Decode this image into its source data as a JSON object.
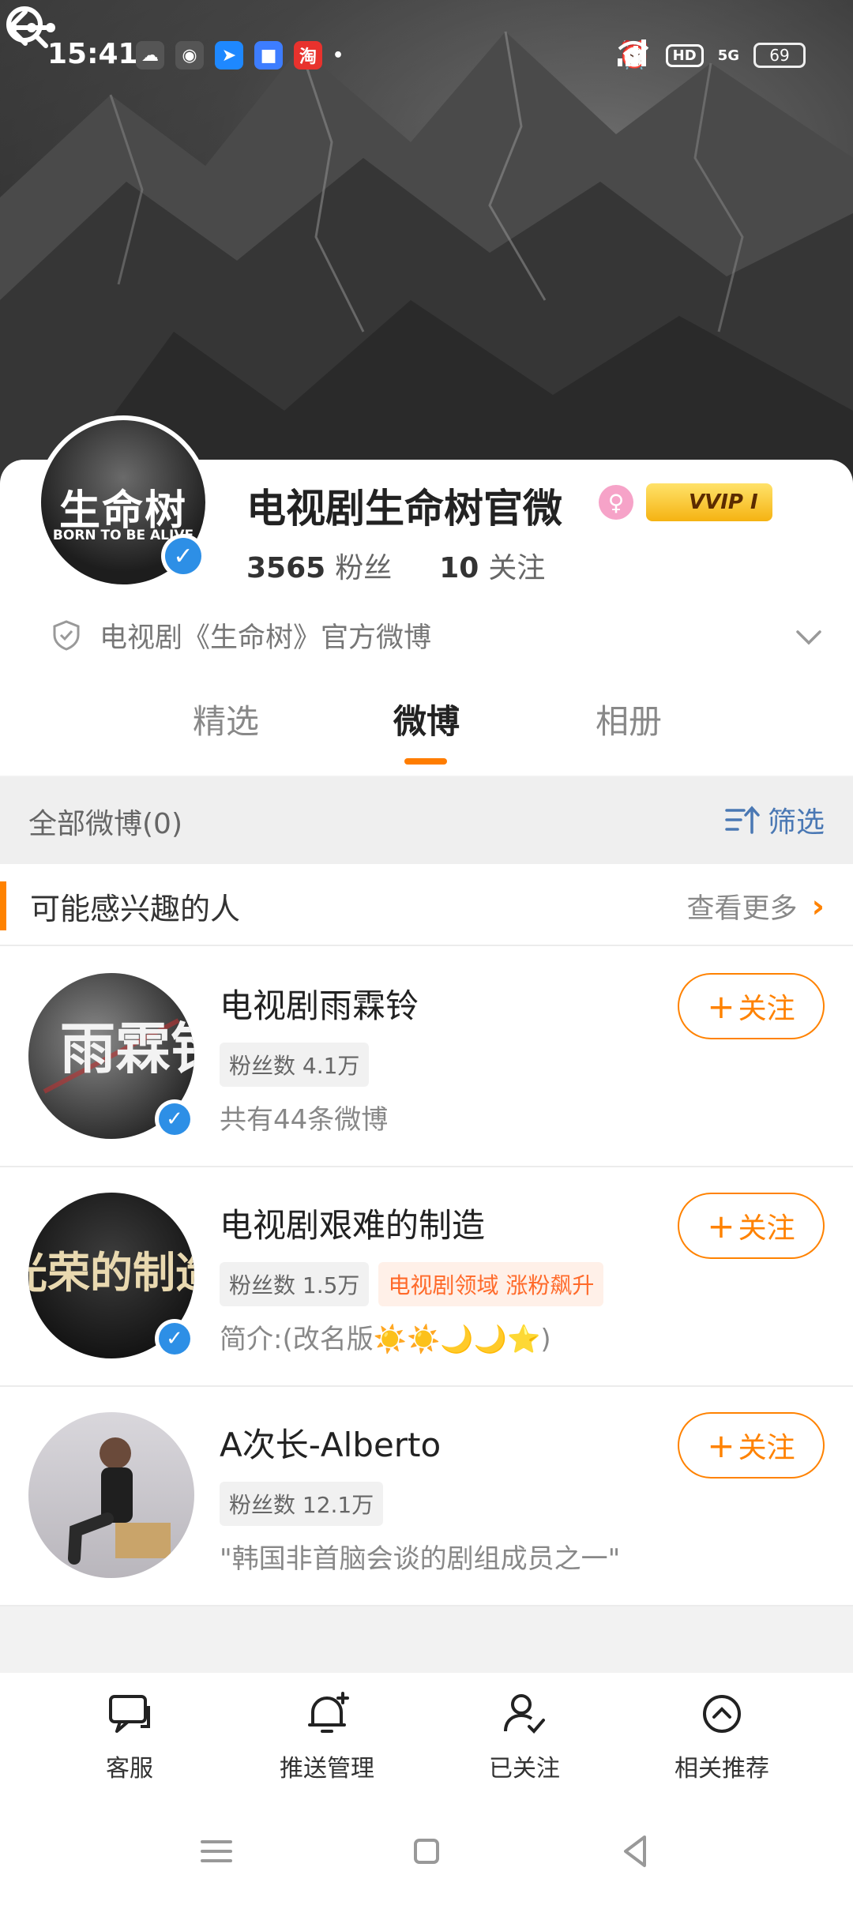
{
  "status_bar": {
    "time": "15:41",
    "apps": [
      {
        "icon": "wechat-icon",
        "glyph": "☁",
        "color": "#3a3a3a"
      },
      {
        "icon": "weibo-icon",
        "glyph": "◉",
        "color": "#3a3a3a"
      },
      {
        "icon": "dingtalk-icon",
        "glyph": "➤",
        "color": "#1e88ff"
      },
      {
        "icon": "app-blue-icon",
        "glyph": "■",
        "color": "#3d7dff"
      },
      {
        "icon": "taobao-icon",
        "glyph": "淘",
        "color": "#e8322d"
      }
    ],
    "hd_label": "HD",
    "network_label": "5G",
    "battery": "69"
  },
  "profile": {
    "name": "电视剧生命树官微",
    "avatar_title": "生命树",
    "avatar_subtitle": "BORN TO BE ALIVE",
    "vvip_label": "VVIP Ⅰ",
    "followers_count": "3565",
    "followers_label": "粉丝",
    "following_count": "10",
    "following_label": "关注",
    "description": "电视剧《生命树》官方微博"
  },
  "tabs": [
    {
      "label": "精选",
      "active": false
    },
    {
      "label": "微博",
      "active": true
    },
    {
      "label": "相册",
      "active": false
    }
  ],
  "filter": {
    "title": "全部微博(0)",
    "button_label": "筛选"
  },
  "suggestions": {
    "title": "可能感兴趣的人",
    "see_more": "查看更多",
    "people": [
      {
        "name": "电视剧雨霖铃",
        "avatar_text": "雨霖铃",
        "tags": [
          "粉丝数 4.1万"
        ],
        "hot_tag": "",
        "desc": "共有44条微博",
        "verified": true,
        "follow_label": "关注"
      },
      {
        "name": "电视剧艰难的制造",
        "avatar_text": "光荣的制造",
        "tags": [
          "粉丝数 1.5万"
        ],
        "hot_tag": "电视剧领域 涨粉飙升",
        "desc": "简介:(改名版☀️☀️🌙🌙⭐)",
        "verified": true,
        "follow_label": "关注"
      },
      {
        "name": "A次长-Alberto",
        "avatar_text": "",
        "tags": [
          "粉丝数 12.1万"
        ],
        "hot_tag": "",
        "desc": "\"韩国非首脑会谈的剧组成员之一\"",
        "verified": false,
        "follow_label": "关注"
      }
    ]
  },
  "bottom_actions": [
    {
      "label": "客服",
      "icon": "chat-icon"
    },
    {
      "label": "推送管理",
      "icon": "bell-icon"
    },
    {
      "label": "已关注",
      "icon": "user-check-icon"
    },
    {
      "label": "相关推荐",
      "icon": "chevron-up-circle-icon"
    }
  ],
  "colors": {
    "accent": "#ff8200",
    "verified": "#2d8fe6",
    "link": "#4a78b4"
  }
}
